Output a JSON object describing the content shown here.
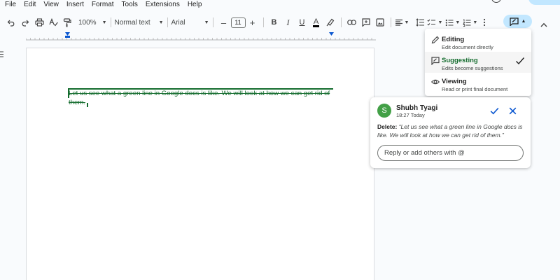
{
  "menu": [
    "File",
    "Edit",
    "View",
    "Insert",
    "Format",
    "Tools",
    "Extensions",
    "Help"
  ],
  "toolbar": {
    "zoom": "100%",
    "style": "Normal text",
    "font": "Arial",
    "font_size": "11",
    "bold": "B",
    "italic": "I",
    "underline": "U",
    "text_color": "A"
  },
  "document": {
    "suggested_deletion": "Let us see what a green line in Google docs is like. We will look at how we can get rid of them."
  },
  "mode_menu": {
    "items": [
      {
        "title": "Editing",
        "desc": "Edit document directly"
      },
      {
        "title": "Suggesting",
        "desc": "Edits become suggestions"
      },
      {
        "title": "Viewing",
        "desc": "Read or print final document"
      }
    ]
  },
  "comment": {
    "avatar_letter": "S",
    "author": "Shubh Tyagi",
    "time": "18:27 Today",
    "action": "Delete:",
    "quote": "“Let us see what a green line in Google docs is like. We will look at how we can get rid of them.”",
    "reply_placeholder": "Reply or add others with @"
  },
  "colors": {
    "suggestion_green": "#146c2e",
    "accent_blue": "#0b57d0",
    "mode_button_bg": "#c2e7ff",
    "avatar_green": "#43a047"
  },
  "icons": [
    "undo-icon",
    "redo-icon",
    "print-icon",
    "spellcheck-icon",
    "paint-format-icon",
    "highlight-icon",
    "link-icon",
    "add-comment-icon",
    "image-icon",
    "align-icon",
    "line-spacing-icon",
    "checklist-icon",
    "bullet-list-icon",
    "numbered-list-icon",
    "more-icon",
    "suggest-mode-icon",
    "chevron-up-icon",
    "pencil-icon",
    "suggest-icon",
    "eye-icon",
    "check-icon",
    "close-icon"
  ]
}
